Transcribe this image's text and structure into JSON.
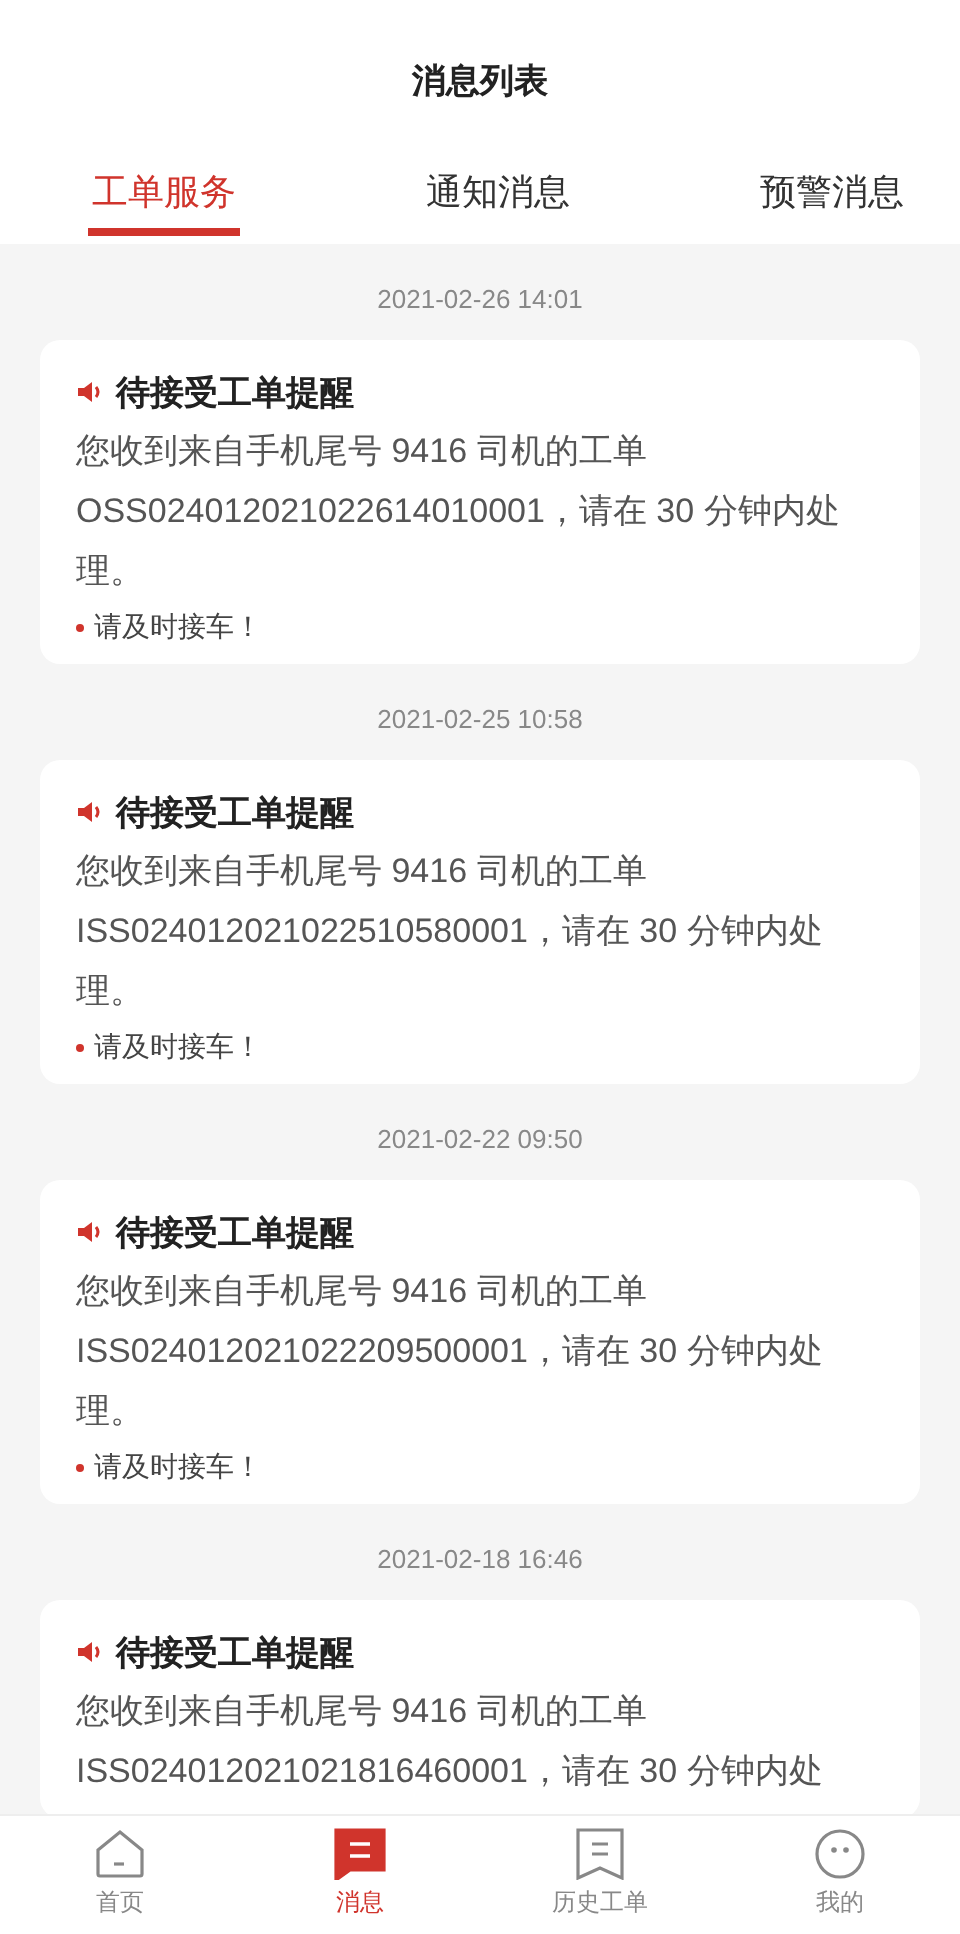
{
  "header": {
    "title": "消息列表"
  },
  "tabs": [
    {
      "label": "工单服务",
      "selected": true
    },
    {
      "label": "通知消息",
      "selected": false
    },
    {
      "label": "预警消息",
      "selected": false
    }
  ],
  "messages": [
    {
      "time": "2021-02-26 14:01",
      "title": "待接受工单提醒",
      "body": "您收到来自手机尾号 9416 司机的工单OSS024012021022614010001，请在 30 分钟内处理。",
      "note": "请及时接车！"
    },
    {
      "time": "2021-02-25 10:58",
      "title": "待接受工单提醒",
      "body": "您收到来自手机尾号 9416 司机的工单ISS024012021022510580001，请在 30 分钟内处理。",
      "note": "请及时接车！"
    },
    {
      "time": "2021-02-22 09:50",
      "title": "待接受工单提醒",
      "body": "您收到来自手机尾号 9416 司机的工单ISS024012021022209500001，请在 30 分钟内处理。",
      "note": "请及时接车！"
    },
    {
      "time": "2021-02-18 16:46",
      "title": "待接受工单提醒",
      "body": "您收到来自手机尾号 9416 司机的工单ISS024012021021816460001，请在 30 分钟内处"
    }
  ],
  "nav": [
    {
      "label": "首页",
      "kind": "home",
      "selected": false
    },
    {
      "label": "消息",
      "kind": "message",
      "selected": true
    },
    {
      "label": "历史工单",
      "kind": "history",
      "selected": false
    },
    {
      "label": "我的",
      "kind": "profile",
      "selected": false
    }
  ]
}
